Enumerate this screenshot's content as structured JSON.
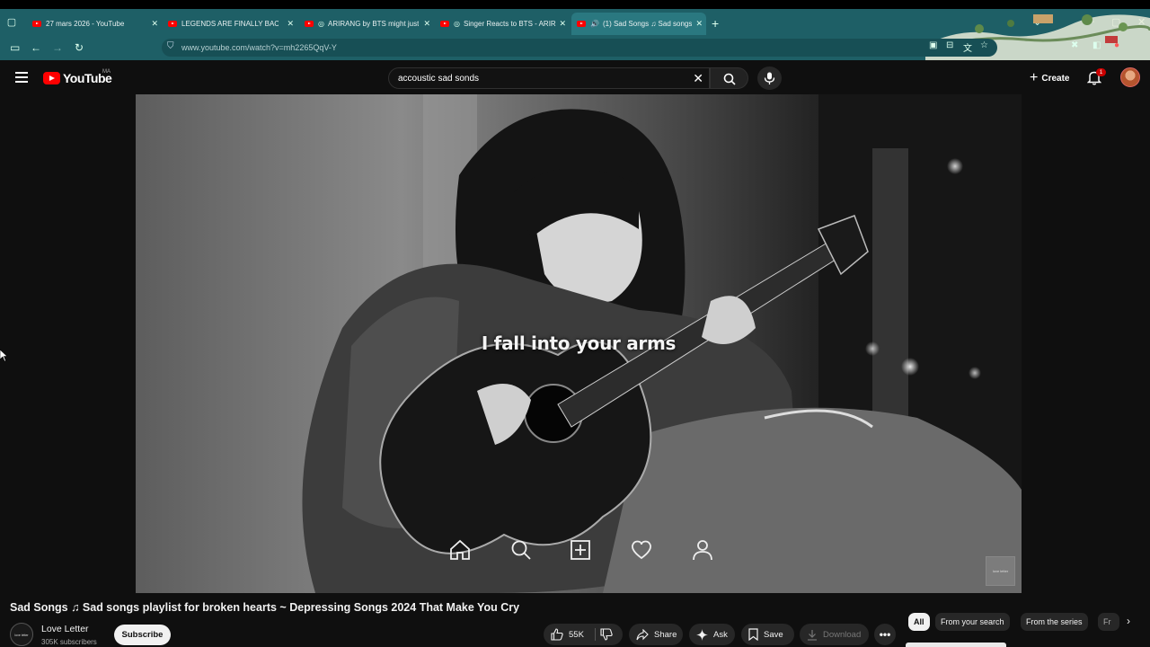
{
  "browser": {
    "tabs": [
      {
        "label": "27 mars 2026 - YouTube",
        "active": false
      },
      {
        "label": "LEGENDS ARE FINALLY BACK!",
        "active": false
      },
      {
        "label": "ARIRANG by BTS might just",
        "active": false
      },
      {
        "label": "Singer Reacts to BTS - ARIR",
        "active": false
      },
      {
        "label": "(1) Sad Songs ♫ Sad songs",
        "active": true
      }
    ],
    "new_tab": "+",
    "url": "www.youtube.com/watch?v=mh2265QqV-Y",
    "icons": [
      "tab-search-icon",
      "sidebar-icon",
      "back-icon",
      "forward-icon",
      "reload-icon",
      "site-info-icon",
      "picture-in-picture-icon",
      "install-icon",
      "translate-icon",
      "bookmark-star-icon",
      "extensions-icon",
      "minimize-icon",
      "maximize-icon",
      "close-icon"
    ]
  },
  "youtube": {
    "logo_text": "YouTube",
    "country_code": "MA",
    "search": {
      "value": "accoustic sad sonds"
    },
    "create_label": "Create",
    "notification_count": "1"
  },
  "video": {
    "lyric": "I fall into your arms",
    "overlay_icons": [
      "home-icon",
      "search-icon",
      "add-icon",
      "heart-icon",
      "profile-icon"
    ],
    "watermark": "love letter",
    "title": "Sad Songs ♫ Sad songs playlist for broken hearts ~ Depressing Songs 2024 That Make You Cry"
  },
  "channel": {
    "name": "Love Letter",
    "subscribers": "305K subscribers",
    "avatar_text": "love letter",
    "subscribe_label": "Subscribe"
  },
  "actions": {
    "likes": "55K",
    "share": "Share",
    "ask": "Ask",
    "save": "Save",
    "download": "Download"
  },
  "chips": [
    "All",
    "From your search",
    "From the series",
    "Fr"
  ],
  "colors": {
    "browser_chrome": "#1e5f66",
    "youtube_red": "#ff0000",
    "page_bg": "#0f0f0f"
  }
}
